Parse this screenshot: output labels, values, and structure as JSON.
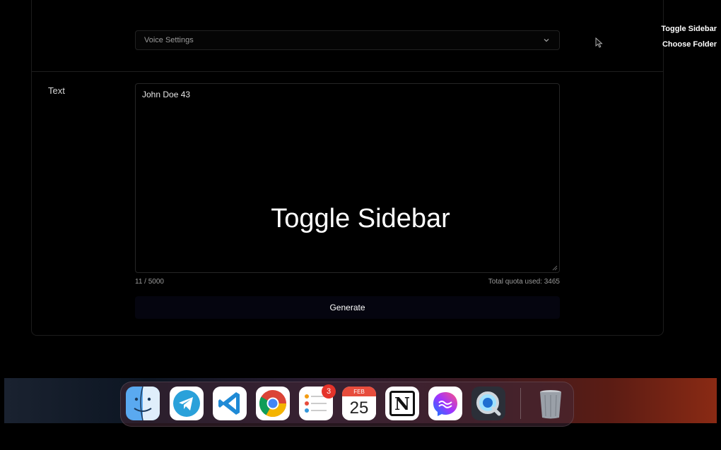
{
  "voice_settings": {
    "label": "Voice Settings"
  },
  "text_section": {
    "label": "Text",
    "value": "John Doe 43",
    "char_count": "11 / 5000",
    "quota": "Total quota used: 3465"
  },
  "generate": {
    "label": "Generate"
  },
  "overlay": {
    "big_label": "Toggle Sidebar",
    "hint_toggle": "Toggle Sidebar",
    "hint_folder": "Choose Folder"
  },
  "dock": {
    "apps": [
      {
        "name": "finder",
        "icon": "finder-icon"
      },
      {
        "name": "telegram",
        "icon": "telegram-icon"
      },
      {
        "name": "vscode",
        "icon": "vscode-icon"
      },
      {
        "name": "chrome",
        "icon": "chrome-icon"
      },
      {
        "name": "reminders",
        "icon": "reminders-icon",
        "badge": "3"
      },
      {
        "name": "calendar",
        "icon": "calendar-icon",
        "month": "FEB",
        "day": "25"
      },
      {
        "name": "notion",
        "icon": "notion-icon",
        "glyph": "N"
      },
      {
        "name": "messenger",
        "icon": "messenger-icon"
      },
      {
        "name": "quicktime",
        "icon": "quicktime-icon"
      },
      {
        "name": "trash",
        "icon": "trash-icon"
      }
    ]
  },
  "colors": {
    "background": "#000000",
    "generate_bg": "#05050f",
    "badge": "#e5332a"
  }
}
